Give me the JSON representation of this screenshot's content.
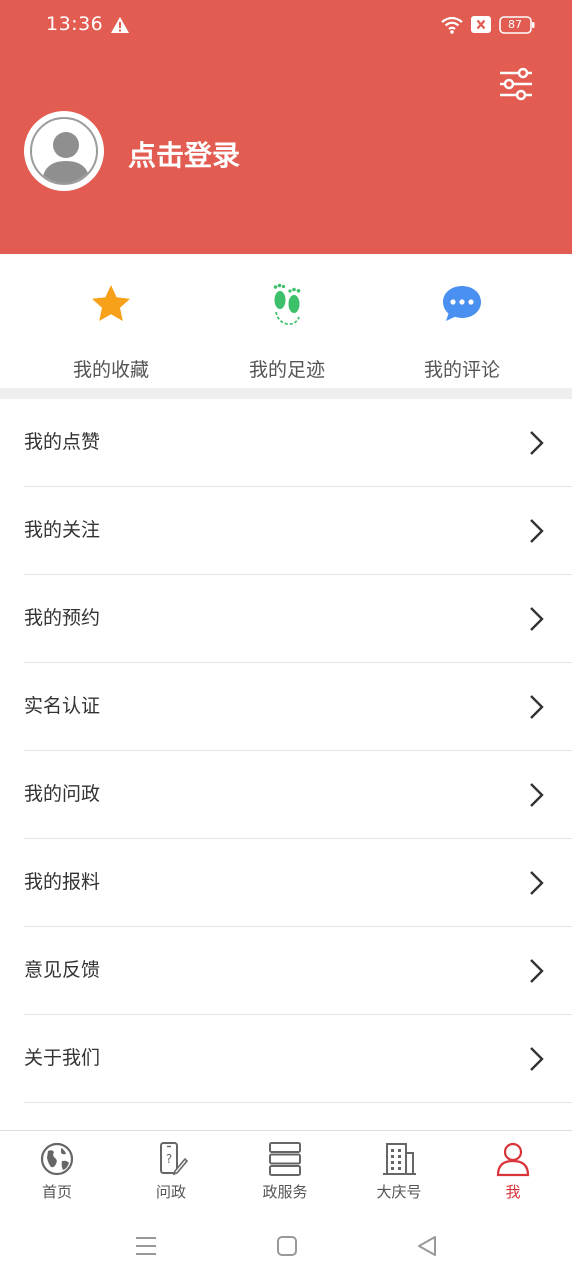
{
  "status_bar": {
    "time": "13:36",
    "battery": "87"
  },
  "header": {
    "login_text": "点击登录",
    "background": "#e25c51"
  },
  "quick_actions": [
    {
      "label": "我的收藏",
      "icon": "star-icon",
      "color": "#f7a11a"
    },
    {
      "label": "我的足迹",
      "icon": "footprints-icon",
      "color": "#3cc06a"
    },
    {
      "label": "我的评论",
      "icon": "chat-bubble-icon",
      "color": "#4a90f0"
    }
  ],
  "menu": [
    {
      "label": "我的点赞"
    },
    {
      "label": "我的关注"
    },
    {
      "label": "我的预约"
    },
    {
      "label": "实名认证"
    },
    {
      "label": "我的问政"
    },
    {
      "label": "我的报料"
    },
    {
      "label": "意见反馈"
    },
    {
      "label": "关于我们"
    }
  ],
  "tabs": [
    {
      "label": "首页",
      "icon": "globe-icon",
      "active": false
    },
    {
      "label": "问政",
      "icon": "phone-question-icon",
      "active": false
    },
    {
      "label": "政服务",
      "icon": "server-icon",
      "active": false
    },
    {
      "label": "大庆号",
      "icon": "building-icon",
      "active": false
    },
    {
      "label": "我",
      "icon": "person-icon",
      "active": true
    }
  ],
  "colors": {
    "accent": "#d8343a",
    "header": "#e25c51"
  }
}
